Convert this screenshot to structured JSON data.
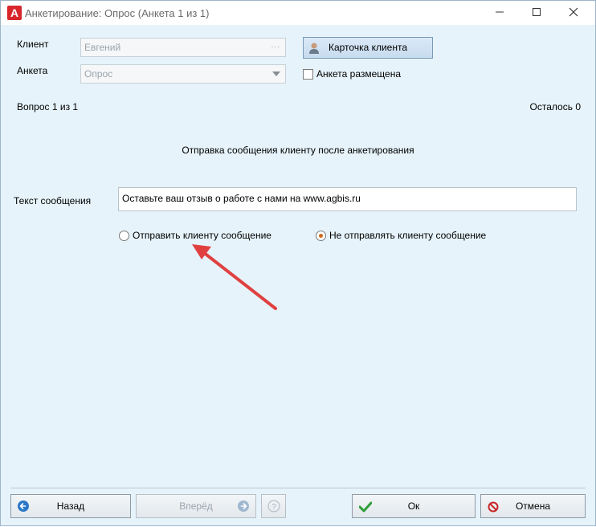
{
  "window": {
    "title": "Анкетирование: Опрос (Анкета 1 из 1)",
    "app_icon_letter": "A"
  },
  "form": {
    "client_label": "Клиент",
    "client_value": "Евгений",
    "client_dots": "...",
    "client_card_button": "Карточка клиента",
    "survey_label": "Анкета",
    "survey_value": "Опрос",
    "posted_label": "Анкета размещена",
    "posted_checked": false
  },
  "progress": {
    "question_text": "Вопрос 1 из 1",
    "remaining_text": "Осталось 0"
  },
  "section_title": "Отправка сообщения клиенту после анкетирования",
  "message": {
    "label": "Текст сообщения",
    "value": "Оставьте ваш отзыв о работе с нами на www.agbis.ru"
  },
  "options": [
    {
      "label": "Отправить клиенту сообщение",
      "selected": false
    },
    {
      "label": "Не отправлять клиенту сообщение",
      "selected": true
    }
  ],
  "footer": {
    "back": "Назад",
    "forward": "Вперёд",
    "help": "?",
    "ok": "Ок",
    "cancel": "Отмена"
  },
  "colors": {
    "background": "#e6f3fa",
    "accent_radio": "#d2691e",
    "annotation_arrow": "#e04040",
    "ok_check": "#2e9e3a",
    "cancel_icon": "#c62828",
    "nav_icon": "#2a78c8"
  }
}
